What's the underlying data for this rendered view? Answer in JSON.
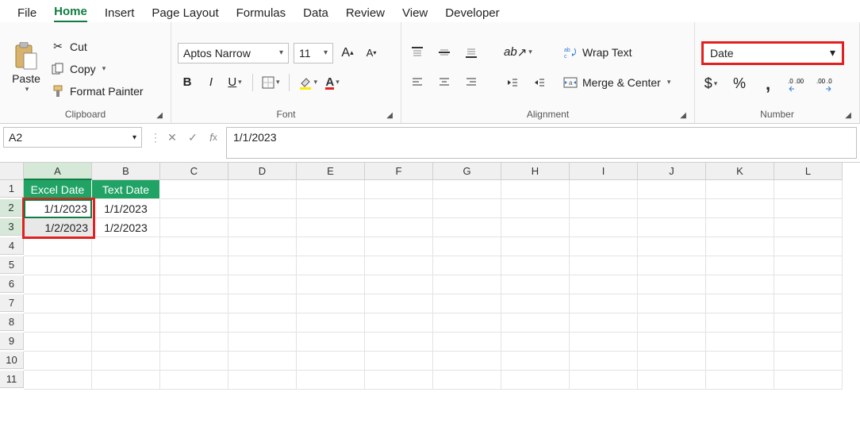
{
  "tabs": [
    "File",
    "Home",
    "Insert",
    "Page Layout",
    "Formulas",
    "Data",
    "Review",
    "View",
    "Developer"
  ],
  "activeTab": "Home",
  "clipboard": {
    "paste": "Paste",
    "cut": "Cut",
    "copy": "Copy",
    "formatPainter": "Format Painter",
    "groupLabel": "Clipboard"
  },
  "font": {
    "name": "Aptos Narrow",
    "size": "11",
    "groupLabel": "Font"
  },
  "alignment": {
    "wrap": "Wrap Text",
    "merge": "Merge & Center",
    "groupLabel": "Alignment"
  },
  "number": {
    "format": "Date",
    "groupLabel": "Number"
  },
  "nameBox": "A2",
  "formula": "1/1/2023",
  "columns": [
    "A",
    "B",
    "C",
    "D",
    "E",
    "F",
    "G",
    "H",
    "I",
    "J",
    "K",
    "L"
  ],
  "rows": [
    "1",
    "2",
    "3",
    "4",
    "5",
    "6",
    "7",
    "8",
    "9",
    "10",
    "11"
  ],
  "headers": {
    "A": "Excel Date",
    "B": "Text Date"
  },
  "cells": {
    "A2": "1/1/2023",
    "A3": "1/2/2023",
    "B2": "1/1/2023",
    "B3": "1/2/2023"
  }
}
